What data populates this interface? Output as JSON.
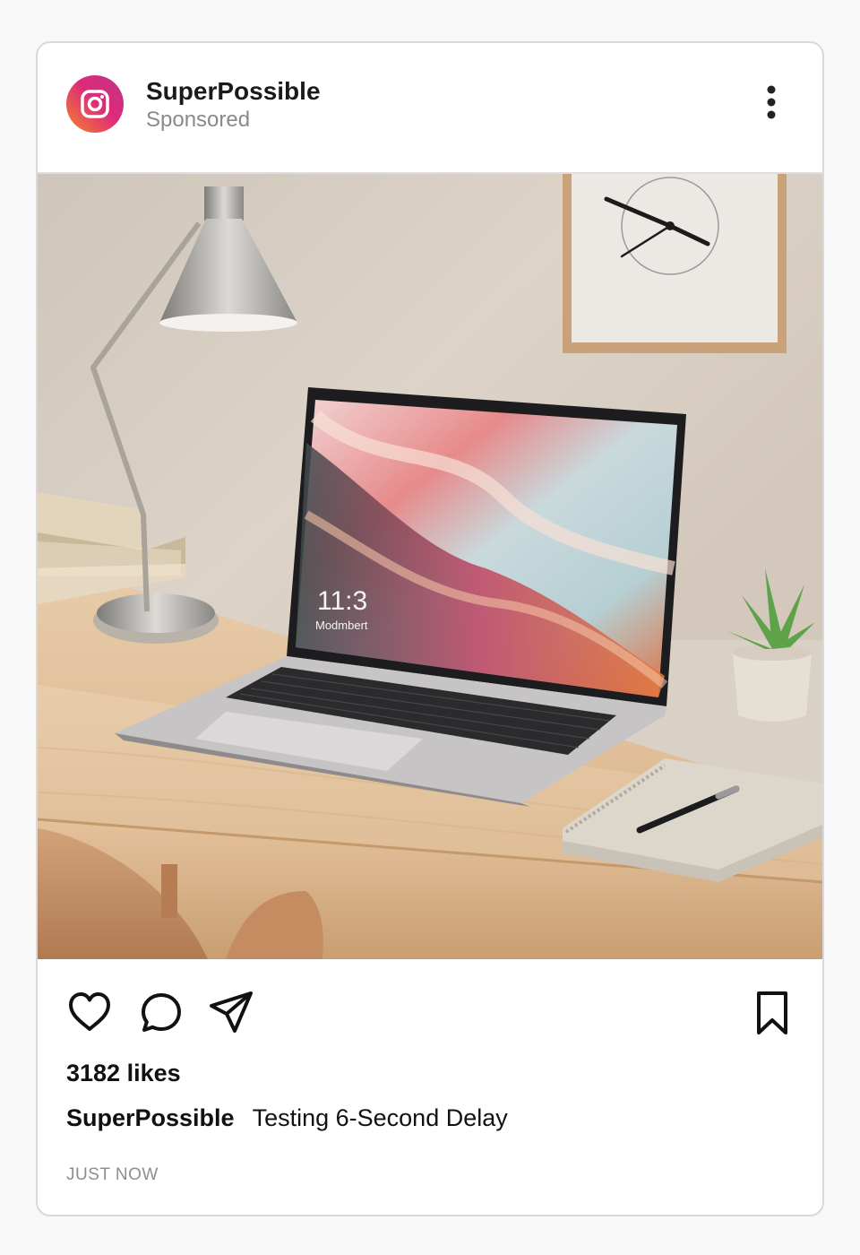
{
  "post": {
    "account_name": "SuperPossible",
    "label": "Sponsored",
    "likes_text": "3182 likes",
    "caption_user": "SuperPossible",
    "caption_text": "Testing 6-Second Delay",
    "timestamp": "JUST NOW"
  },
  "icons": {
    "avatar": "instagram-logo-icon",
    "more": "more-vertical-icon",
    "like": "heart-icon",
    "comment": "comment-icon",
    "share": "send-icon",
    "save": "bookmark-icon"
  },
  "screen_text": {
    "time": "11:3",
    "date": "Modmbert"
  },
  "colors": {
    "avatar_gradient_start": "#f58529",
    "avatar_gradient_end": "#c13584",
    "secondary_text": "#8a8a8a"
  }
}
